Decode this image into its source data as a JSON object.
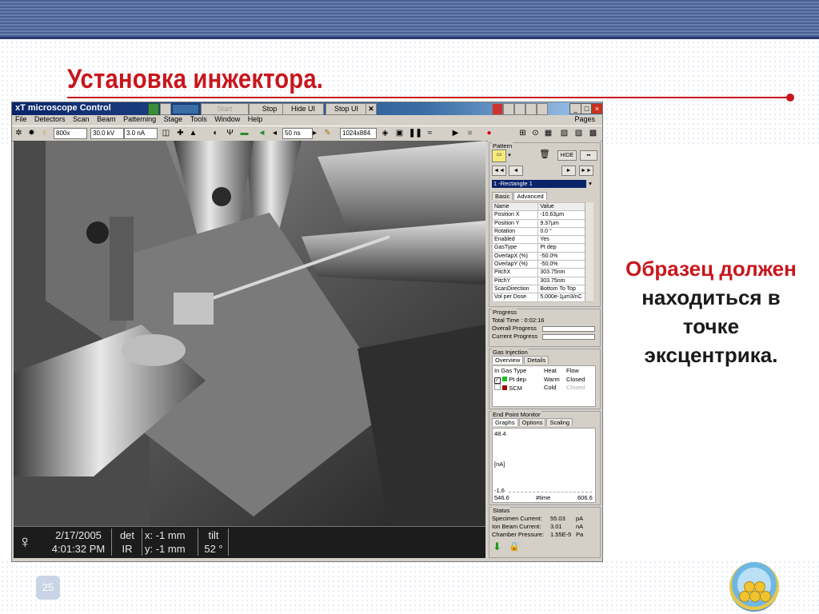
{
  "slide": {
    "title": "Установка инжектора.",
    "note_lines": [
      "Образец должен",
      "находиться в",
      "точке",
      "эксцентрика."
    ],
    "page_number": "25",
    "colors": {
      "accent": "#c8161d",
      "band": "#4a5f92"
    }
  },
  "app": {
    "title": "xT microscope Control",
    "buttons": {
      "start": "Start",
      "stop": "Stop",
      "hide_ui": "Hide UI",
      "stop_ui": "Stop UI",
      "close": "✕"
    },
    "menu": [
      "File",
      "Detectors",
      "Scan",
      "Beam",
      "Patterning",
      "Stage",
      "Tools",
      "Window",
      "Help"
    ],
    "pages_label": "Pages",
    "toolbar": {
      "magnification": "800x",
      "voltage": "30.0 kV",
      "current": "3.0 nA",
      "dwell": "50 ns",
      "resolution": "1024x884"
    }
  },
  "databar": {
    "date": "2/17/2005",
    "time": "4:01:32 PM",
    "det_label": "det",
    "det_value": "IR",
    "x": "x: -1 mm",
    "y": "y: -1 mm",
    "tilt_label": "tilt",
    "tilt_value": "52 °"
  },
  "pattern": {
    "caption": "Pattern",
    "hide": "HIDE",
    "selected": "1 -Rectangle 1",
    "tabs": [
      "Basic",
      "Advanced"
    ],
    "header": [
      "Name",
      "Value"
    ],
    "rows": [
      [
        "Position X",
        "-10.63µm"
      ],
      [
        "Position Y",
        "9.37µm"
      ],
      [
        "Rotation",
        "0.0 °"
      ],
      [
        "Enabled",
        "Yes"
      ],
      [
        "GasType",
        "Pt dep"
      ],
      [
        "OverlapX (%)",
        "-50.0%"
      ],
      [
        "OverlapY (%)",
        "-50.0%"
      ],
      [
        "PitchX",
        "303.75nm"
      ],
      [
        "PitchY",
        "303.75nm"
      ],
      [
        "ScanDirection",
        "Bottom To Top"
      ],
      [
        "Vol per Dose",
        "5.000e-1µm3/nC"
      ]
    ]
  },
  "progress": {
    "caption": "Progress",
    "total": "Total Time :  0:02:16",
    "overall": "Overall Progress",
    "current": "Current Progress"
  },
  "gas": {
    "caption": "Gas Injection",
    "tabs": [
      "Overview",
      "Details"
    ],
    "header": [
      "In Gas Type",
      "Heat",
      "Flow"
    ],
    "rows": [
      [
        "Pt dep",
        "Warm",
        "Closed"
      ],
      [
        "SCM",
        "Cold",
        "Closed"
      ]
    ]
  },
  "endpoint": {
    "caption": "End Point Monitor",
    "tabs": [
      "Graphs",
      "Options",
      "Scaling"
    ],
    "ymax": "48.4",
    "yunit": "[nA]",
    "ymin": "-1.6",
    "xmin": "546.6",
    "xlabel": "#time",
    "xmax": "606.6"
  },
  "status": {
    "caption": "Status",
    "rows": [
      [
        "Specimen Current:",
        "55.03",
        "pA"
      ],
      [
        "Ion Beam Current:",
        "3.01",
        "nA"
      ],
      [
        "Chamber Pressure:",
        "1.55E-5",
        "Pa"
      ]
    ]
  }
}
